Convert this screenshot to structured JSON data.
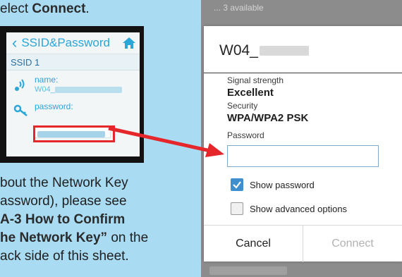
{
  "instructions": {
    "top_prefix": "elect ",
    "top_bold": "Connect",
    "top_suffix": ".",
    "lines": [
      {
        "plain": "bout the Network Key",
        "bold": "",
        "after": ""
      },
      {
        "plain": "assword), please see",
        "bold": "",
        "after": ""
      },
      {
        "plain": "",
        "bold": "A-3 How to Confirm",
        "after": ""
      },
      {
        "plain": "",
        "bold": "he Network Key”",
        "after": " on the"
      },
      {
        "plain": "ack side of this sheet.",
        "bold": "",
        "after": ""
      }
    ]
  },
  "phone": {
    "header_title": "SSID&Password",
    "ssid_label": "SSID 1",
    "name_label": "name:",
    "name_value": "W04_",
    "password_label": "password:"
  },
  "android": {
    "bg_top_text": "... 3 available",
    "dialog_title": "W04_",
    "signal_label": "Signal strength",
    "signal_value": "Excellent",
    "security_label": "Security",
    "security_value": "WPA/WPA2 PSK",
    "password_label": "Password",
    "password_value": "",
    "show_password": "Show password",
    "show_password_checked": true,
    "show_advanced": "Show advanced options",
    "show_advanced_checked": false,
    "cancel": "Cancel",
    "connect": "Connect"
  },
  "colors": {
    "background": "#a9dcf3",
    "accent_blue": "#2aa6d8",
    "highlight_red": "#e5262a",
    "checkbox_blue": "#3f8ecd"
  }
}
